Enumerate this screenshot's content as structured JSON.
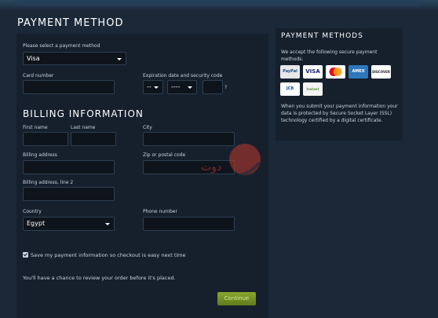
{
  "page_title": "PAYMENT METHOD",
  "payment": {
    "select_label": "Please select a payment method",
    "selected_method": "Visa",
    "card_number_label": "Card number",
    "card_number_value": "",
    "expiration_label": "Expiration date and security code",
    "exp_month": "--",
    "exp_year": "----",
    "security_code": "",
    "help_mark": "?"
  },
  "billing": {
    "title": "BILLING INFORMATION",
    "first_name_label": "First name",
    "last_name_label": "Last name",
    "city_label": "City",
    "address_label": "Billing address",
    "zip_label": "Zip or postal code",
    "address2_label": "Billing address, line 2",
    "country_label": "Country",
    "country_value": "Egypt",
    "phone_label": "Phone number"
  },
  "save_label": "Save my payment information so checkout is easy next time",
  "save_checked": true,
  "review_note": "You'll have a chance to review your order before it's placed.",
  "continue_label": "Continue",
  "sidebar": {
    "title": "PAYMENT METHODS",
    "intro": "We accept the following secure payment methods:",
    "cards": [
      "PayPal",
      "VISA",
      "MasterCard",
      "AMEX",
      "DISCOVER",
      "JCB",
      "Instant"
    ],
    "security_text": "When you submit your payment information your data is protected by Secure Socket Layer (SSL) technology certified by a digital certificate."
  },
  "watermark": "دوت",
  "colors": {
    "background": "#1b2838",
    "panel": "#16202d",
    "input": "#0e141b",
    "button": "#6b8a24",
    "watermark": "#c0392b"
  }
}
